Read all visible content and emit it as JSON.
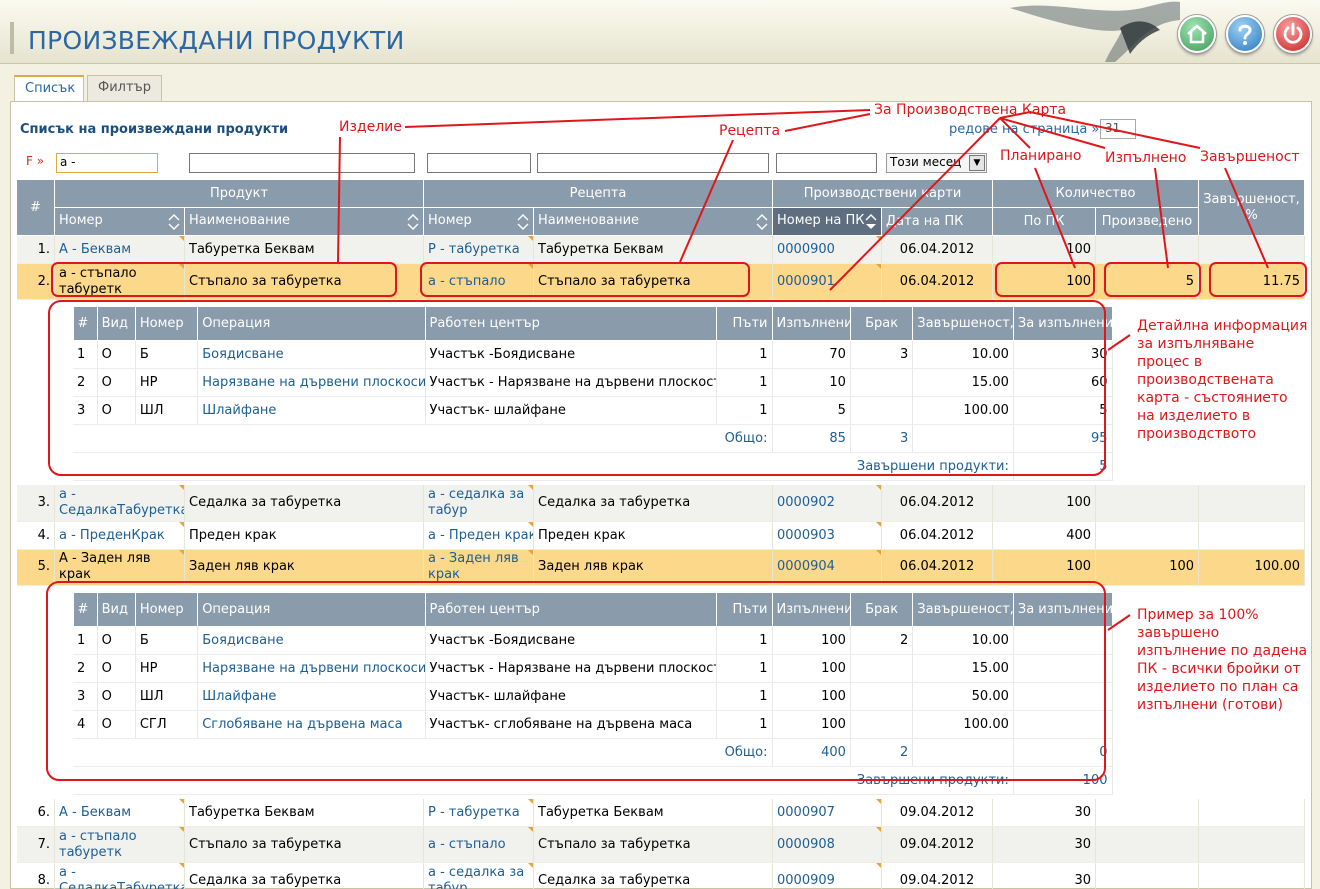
{
  "page_title": "ПРОИЗВЕЖДАНИ ПРОДУКТИ",
  "tabs": [
    "Списък",
    "Филтър"
  ],
  "list_title": "Списък на произвеждани продукти",
  "rows_per_page_label": "редове на страница »",
  "rows_per_page_value": "31",
  "filter": {
    "label": "F »",
    "code_value": "а -",
    "month_value": "Този месец"
  },
  "headers": {
    "group_product": "Продукт",
    "group_recipe": "Рецепта",
    "group_pc": "Производствени карти",
    "group_qty": "Количество",
    "completion": "Завършеност, %",
    "num": "#",
    "product_no": "Номер",
    "product_name": "Наименование",
    "recipe_no": "Номер",
    "recipe_name": "Наименование",
    "pc_no": "Номер на ПК",
    "pc_date": "Дата на ПК",
    "planned": "По ПК",
    "produced": "Произведено"
  },
  "rows": [
    {
      "idx": "1.",
      "product_no": "А - Беквам",
      "product_name": "Табуретка Беквам",
      "recipe_no": "Р - табуретка",
      "recipe_name": "Табуретка Беквам",
      "pc_no": "0000900",
      "pc_date": "06.04.2012",
      "planned": "100",
      "produced": "",
      "completion": ""
    },
    {
      "idx": "2.",
      "product_no": "а - стъпало табуретк",
      "product_name": "Стъпало за табуретка",
      "recipe_no": "а - стъпало",
      "recipe_name": "Стъпало за табуретка",
      "pc_no": "0000901",
      "pc_date": "06.04.2012",
      "planned": "100",
      "produced": "5",
      "completion": "11.75"
    },
    {
      "idx": "3.",
      "product_no": "а - СедалкаТабуретка",
      "product_name": "Седалка за табуретка",
      "recipe_no": "а - седалка за табур",
      "recipe_name": "Седалка за табуретка",
      "pc_no": "0000902",
      "pc_date": "06.04.2012",
      "planned": "100",
      "produced": "",
      "completion": ""
    },
    {
      "idx": "4.",
      "product_no": "а - ПреденКрак",
      "product_name": "Преден крак",
      "recipe_no": "а - Преден крак",
      "recipe_name": "Преден крак",
      "pc_no": "0000903",
      "pc_date": "06.04.2012",
      "planned": "400",
      "produced": "",
      "completion": ""
    },
    {
      "idx": "5.",
      "product_no": "А - Заден ляв крак",
      "product_name": "Заден ляв крак",
      "recipe_no": "а - Заден ляв крак",
      "recipe_name": "Заден ляв крак",
      "pc_no": "0000904",
      "pc_date": "06.04.2012",
      "planned": "100",
      "produced": "100",
      "completion": "100.00"
    },
    {
      "idx": "6.",
      "product_no": "А - Беквам",
      "product_name": "Табуретка Беквам",
      "recipe_no": "Р - табуретка",
      "recipe_name": "Табуретка Беквам",
      "pc_no": "0000907",
      "pc_date": "09.04.2012",
      "planned": "30",
      "produced": "",
      "completion": ""
    },
    {
      "idx": "7.",
      "product_no": "а - стъпало табуретк",
      "product_name": "Стъпало за табуретка",
      "recipe_no": "а - стъпало",
      "recipe_name": "Стъпало за табуретка",
      "pc_no": "0000908",
      "pc_date": "09.04.2012",
      "planned": "30",
      "produced": "",
      "completion": ""
    },
    {
      "idx": "8.",
      "product_no": "а - СедалкаТабуретка",
      "product_name": "Седалка за табуретка",
      "recipe_no": "а - седалка за табур",
      "recipe_name": "Седалка за табуретка",
      "pc_no": "0000909",
      "pc_date": "09.04.2012",
      "planned": "30",
      "produced": "",
      "completion": ""
    }
  ],
  "sub_headers": {
    "num": "#",
    "kind": "Вид",
    "no": "Номер",
    "operation": "Операция",
    "center": "Работен център",
    "paths": "Пъти",
    "done": "Изпълнени",
    "scrap": "Брак",
    "completion": "Завършеност, %",
    "todo": "За изпълнение *"
  },
  "detail1": {
    "ops": [
      {
        "n": "1",
        "kind": "О",
        "code": "Б",
        "op": "Боядисване",
        "center": "Участък -Боядисване",
        "paths": "1",
        "done": "70",
        "scrap": "3",
        "compl": "10.00",
        "todo": "30"
      },
      {
        "n": "2",
        "kind": "О",
        "code": "НР",
        "op": "Нарязване на дървени плоскоси",
        "center": "Участък - Нарязване на дървени плоскости",
        "paths": "1",
        "done": "10",
        "scrap": "",
        "compl": "15.00",
        "todo": "60"
      },
      {
        "n": "3",
        "kind": "О",
        "code": "ШЛ",
        "op": "Шлайфане",
        "center": "Участък- шлайфане",
        "paths": "1",
        "done": "5",
        "scrap": "",
        "compl": "100.00",
        "todo": "5"
      }
    ],
    "total_label": "Общо:",
    "total_done": "85",
    "total_scrap": "3",
    "total_todo": "95",
    "finished_label": "Завършени продукти:",
    "finished": "5"
  },
  "detail2": {
    "ops": [
      {
        "n": "1",
        "kind": "О",
        "code": "Б",
        "op": "Боядисване",
        "center": "Участък -Боядисване",
        "paths": "1",
        "done": "100",
        "scrap": "2",
        "compl": "10.00",
        "todo": ""
      },
      {
        "n": "2",
        "kind": "О",
        "code": "НР",
        "op": "Нарязване на дървени плоскоси",
        "center": "Участък - Нарязване на дървени плоскости",
        "paths": "1",
        "done": "100",
        "scrap": "",
        "compl": "15.00",
        "todo": ""
      },
      {
        "n": "3",
        "kind": "О",
        "code": "ШЛ",
        "op": "Шлайфане",
        "center": "Участък- шлайфане",
        "paths": "1",
        "done": "100",
        "scrap": "",
        "compl": "50.00",
        "todo": ""
      },
      {
        "n": "4",
        "kind": "О",
        "code": "СГЛ",
        "op": "Сглобяване на дървена маса",
        "center": "Участък- сглобяване на дървена маса",
        "paths": "1",
        "done": "100",
        "scrap": "",
        "compl": "100.00",
        "todo": ""
      }
    ],
    "total_label": "Общо:",
    "total_done": "400",
    "total_scrap": "2",
    "total_todo": "0",
    "finished_label": "Завършени продукти:",
    "finished": "100"
  },
  "annotations": {
    "pc": "За Производствена Карта",
    "product": "Изделие",
    "recipe": "Рецепта",
    "planned": "Планирано",
    "done": "Изпълнено",
    "completion": "Завършеност",
    "detail_note": "Детайлна информация за изпълняване процес в производствената карта - състоянието на изделието в производството",
    "example_note": "Пример за 100% завършено изпълнение по дадена ПК - всички бройки от изделието по план са изпълнени (готови)"
  },
  "colors": {
    "header_bg": "#8a9bab",
    "selected_row": "#fcd88a",
    "annotation": "#e0161a",
    "link": "#1d5e93",
    "title": "#2c67a3"
  }
}
